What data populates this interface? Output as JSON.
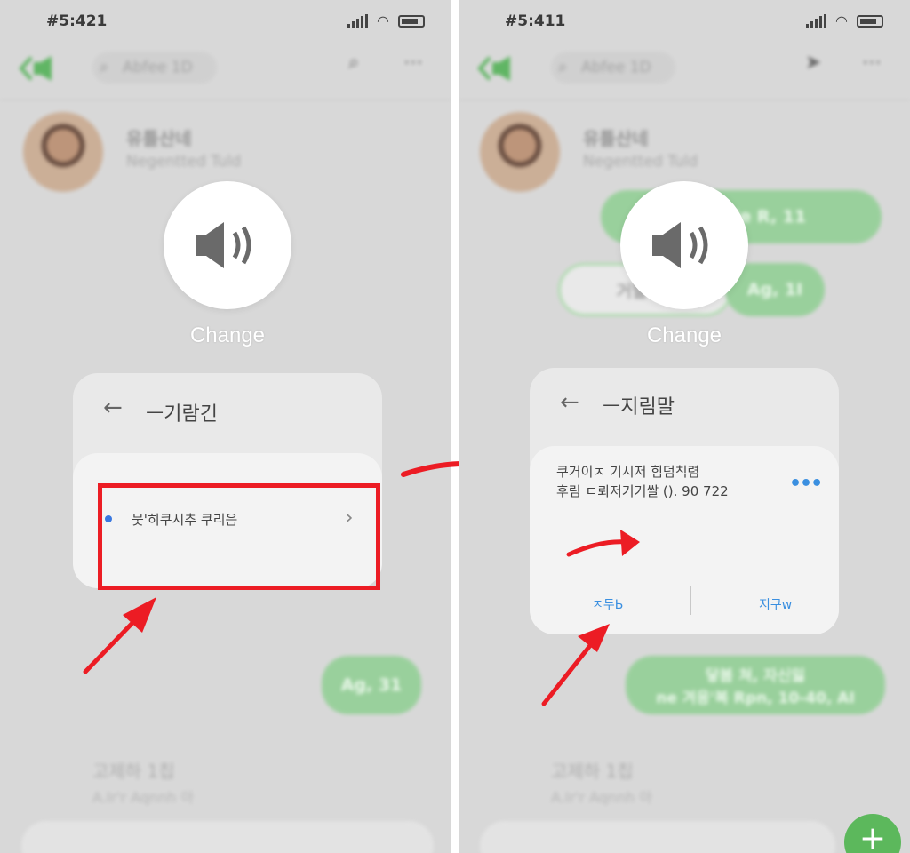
{
  "left": {
    "status_time": "#5:421",
    "search_placeholder": "Abfee 1D",
    "contact_name": "유틀산네",
    "contact_sub": "Negentted Tuld",
    "speaker_label": "Change",
    "sheet_title": "ㅡ기람긴",
    "option_label": "뭇'히쿠시추 쿠리음",
    "bubble_bottom": "Ag, 31",
    "preview_title": "고제하 1칩",
    "preview_sub": "A.Ir'r Aqnnh 아"
  },
  "right": {
    "status_time": "#5:411",
    "search_placeholder": "Abfee 1D",
    "contact_name": "유틀산네",
    "contact_sub": "Negentted Tuld",
    "bubble_top": "Vogtitle R, 11",
    "bubble_outline": "거할 '개",
    "bubble_mid": "Ag, 1I",
    "speaker_label": "Change",
    "sheet_title": "ㅡ지림말",
    "dialog_line1": "쿠거이ㅈ 기시저 힘덤칙렴",
    "dialog_line2": "후림 ㄷ뢰저기거쌀 (). 90 722",
    "button_left": "ㅈ두Ь",
    "button_right": "지쿠ԝ",
    "bubble_bottom_line1": "닿봄 쳐, 자신잃",
    "bubble_bottom_line2": "ne 겨응'복 Rpn,  10-40, AI",
    "preview_title": "고제하 1칩",
    "preview_sub": "A.Ir'r Aqnnh 아",
    "fab_label": "+"
  },
  "colors": {
    "accent_green": "#5cb85c",
    "highlight_red": "#ec1c24",
    "link_blue": "#3a8fe0"
  }
}
